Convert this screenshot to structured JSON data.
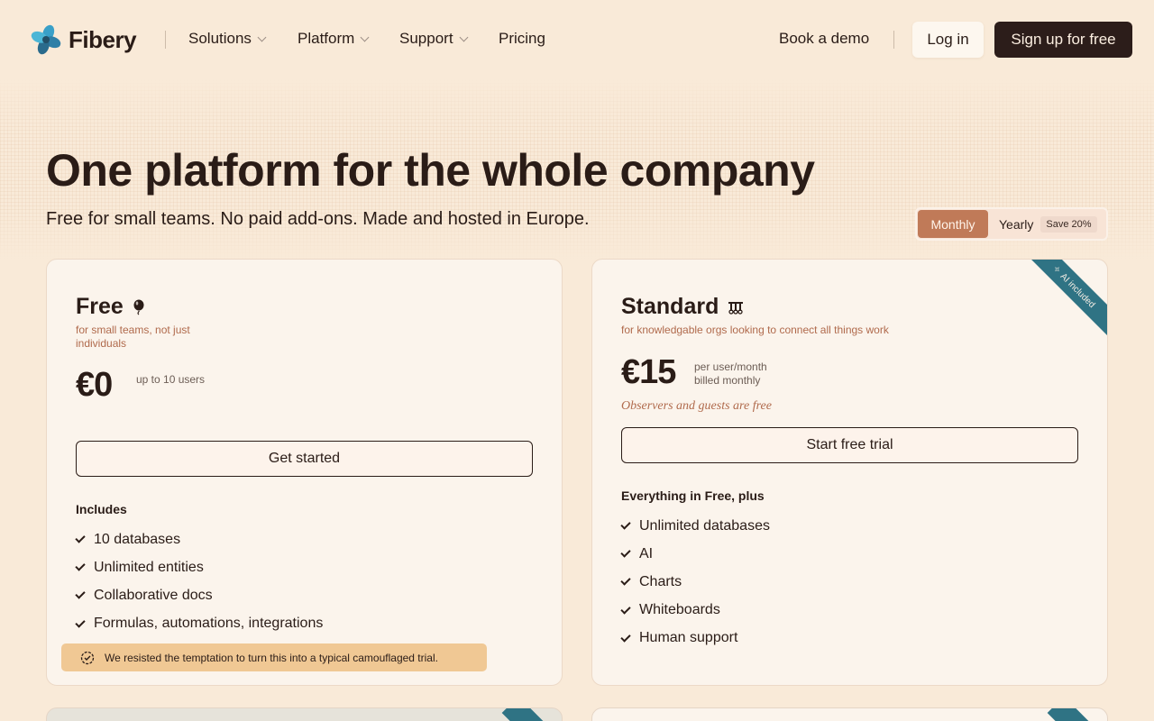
{
  "nav": {
    "brand": "Fibery",
    "items": [
      {
        "label": "Solutions",
        "has_dropdown": true
      },
      {
        "label": "Platform",
        "has_dropdown": true
      },
      {
        "label": "Support",
        "has_dropdown": true
      },
      {
        "label": "Pricing",
        "has_dropdown": false
      }
    ],
    "book_demo": "Book a demo",
    "login": "Log in",
    "signup": "Sign up for free"
  },
  "hero": {
    "title": "One platform for the whole company",
    "subtitle": "Free for small teams. No paid add-ons. Made and hosted in Europe."
  },
  "billing_toggle": {
    "monthly": "Monthly",
    "yearly": "Yearly",
    "save_badge": "Save 20%",
    "selected": "Monthly"
  },
  "plans": {
    "free": {
      "name": "Free",
      "icon": "balloon-icon",
      "description": "for small teams, not just individuals",
      "price": "€0",
      "price_note": "up to 10 users",
      "cta": "Get started",
      "features_heading": "Includes",
      "features": [
        "10 databases",
        "Unlimited entities",
        "Collaborative docs",
        "Formulas, automations, integrations"
      ],
      "note": "We resisted the temptation to turn this into a typical camouflaged trial."
    },
    "standard": {
      "name": "Standard",
      "icon": "tools-icon",
      "description": "for knowledgable orgs looking to connect all things work",
      "price": "€15",
      "price_note_1": "per user/month",
      "price_note_2": "billed monthly",
      "observers": "Observers and guests are free",
      "cta": "Start free trial",
      "features_heading": "Everything in Free, plus",
      "features": [
        "Unlimited databases",
        "AI",
        "Charts",
        "Whiteboards",
        "Human support"
      ],
      "ribbon": "AI included"
    }
  },
  "colors": {
    "background": "#f9ead8",
    "accent": "#c07a58",
    "dark": "#2c1d1a",
    "ribbon": "#2f7384",
    "note_bg": "#f0c894"
  }
}
